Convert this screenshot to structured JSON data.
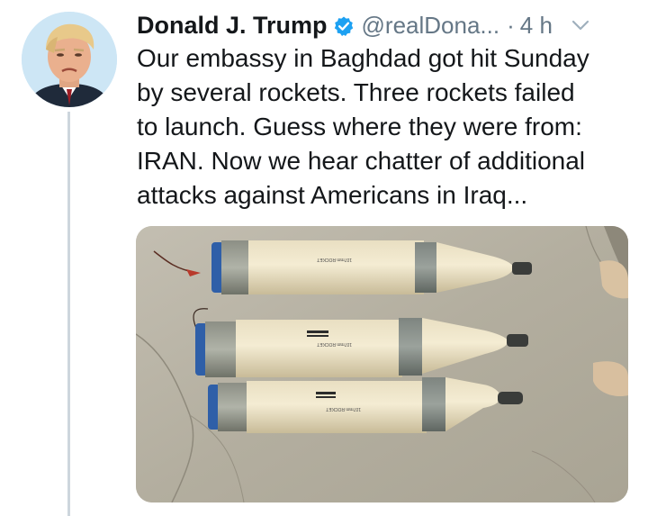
{
  "tweet": {
    "author": {
      "display_name": "Donald J. Trump",
      "handle": "@realDona...",
      "verified": true,
      "avatar_icon": "profile-photo"
    },
    "time_separator": "·",
    "time_ago": "4 h",
    "menu_icon": "chevron-down-icon",
    "text": "Our embassy in Baghdad got hit Sunday\nby several rockets. Three rockets failed\nto launch. Guess where they were from:\nIRAN. Now we hear chatter of additional\nattacks against Americans in Iraq...",
    "media": {
      "type": "photo",
      "photo_label_text": "107mm ROCKET"
    }
  },
  "colors": {
    "text_primary": "#14171a",
    "text_secondary": "#657786",
    "verified_blue": "#1da1f2",
    "thread_line": "#cdd6dd"
  }
}
